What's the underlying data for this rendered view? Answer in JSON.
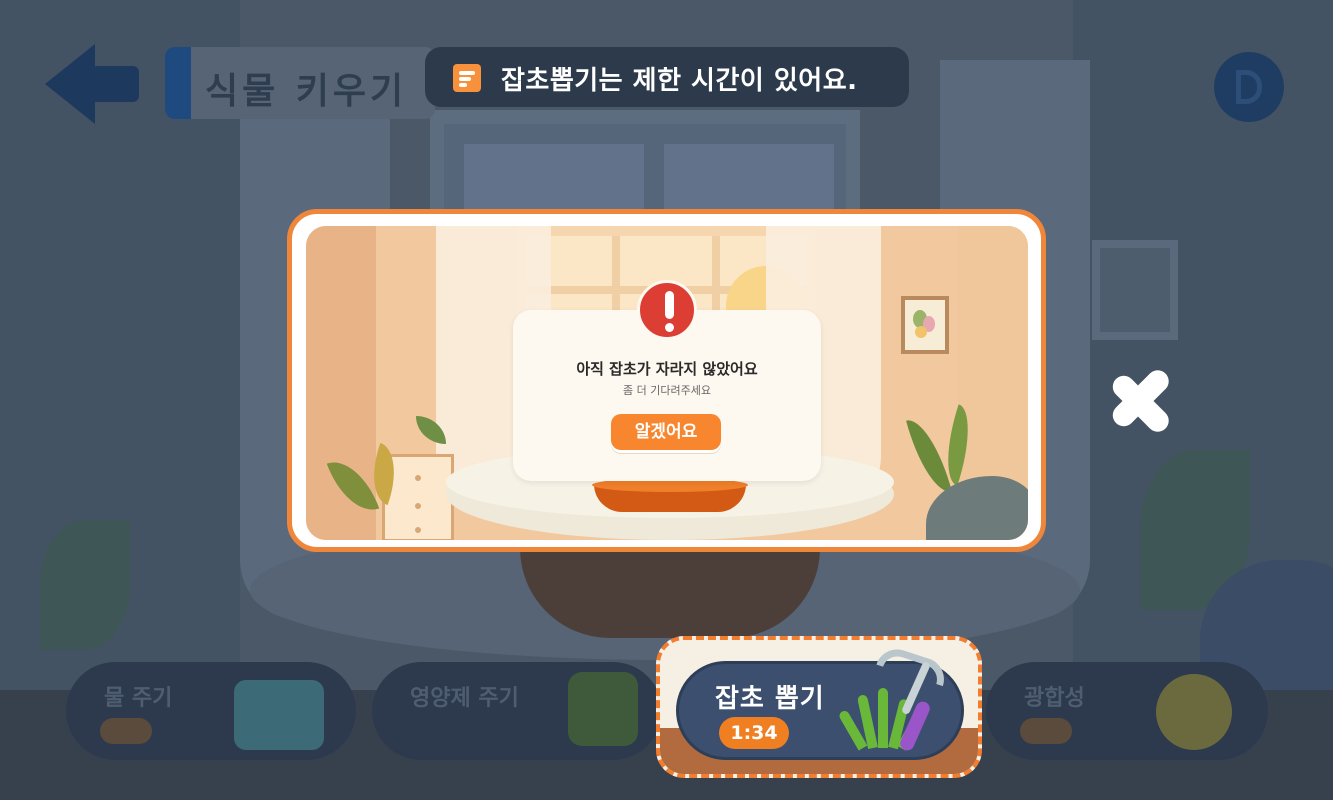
{
  "toast": {
    "icon": "memo-icon",
    "message": "잡초뽑기는 제한 시간이 있어요."
  },
  "header": {
    "title": "식물 키우기"
  },
  "modal": {
    "title": "아직 잡초가 자라지 않았어요",
    "subtitle": "좀 더 기다려주세요",
    "confirm_label": "알겠어요"
  },
  "actions": {
    "water_label": "물 주기",
    "fertilizer_label": "영양제 주기",
    "weed_label": "잡초 뽑기",
    "weed_timer": "1:34",
    "sun_label": "광합성"
  },
  "colors": {
    "accent": "#f0863a",
    "alert": "#dd3e34",
    "toast_bg": "#2d3a4b",
    "action_card": "#3c4f6e"
  }
}
